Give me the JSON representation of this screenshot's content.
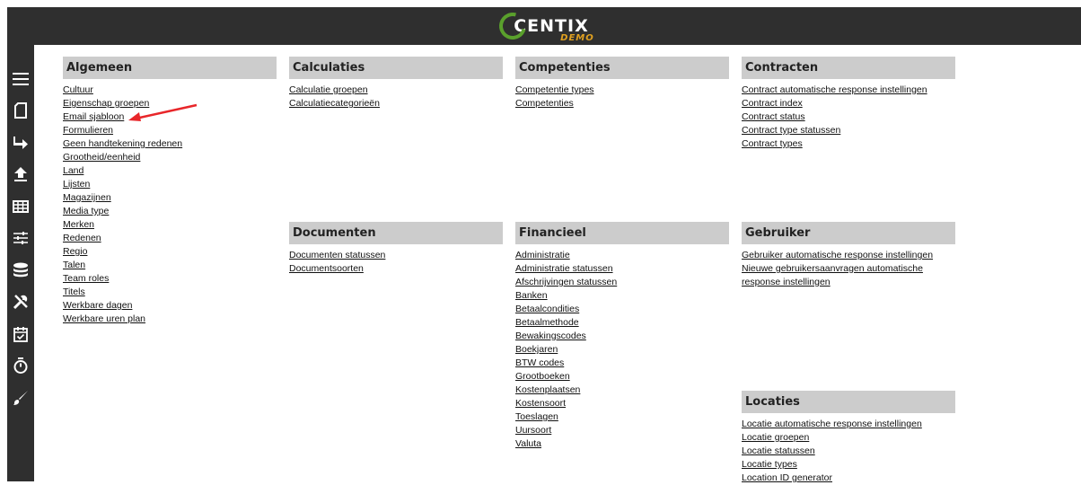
{
  "header": {
    "logo_text": "CENTIX",
    "logo_sub": "DEMO"
  },
  "sidebar": {
    "items": [
      {
        "icon": "menu-icon"
      },
      {
        "icon": "document-icon"
      },
      {
        "icon": "share-arrow-icon"
      },
      {
        "icon": "upload-icon"
      },
      {
        "icon": "table-icon"
      },
      {
        "icon": "sliders-icon"
      },
      {
        "icon": "database-icon"
      },
      {
        "icon": "tools-icon"
      },
      {
        "icon": "calendar-check-icon"
      },
      {
        "icon": "stopwatch-icon"
      },
      {
        "icon": "paintbrush-icon"
      }
    ]
  },
  "sections": {
    "algemeen": {
      "title": "Algemeen",
      "links": [
        "Cultuur",
        "Eigenschap groepen",
        "Email sjabloon",
        "Formulieren",
        "Geen handtekening redenen",
        "Grootheid/eenheid",
        "Land",
        "Lijsten",
        "Magazijnen",
        "Media type",
        "Merken",
        "Redenen",
        "Regio",
        "Talen",
        "Team roles",
        "Titels",
        "Werkbare dagen",
        "Werkbare uren plan"
      ]
    },
    "calculaties": {
      "title": "Calculaties",
      "links": [
        "Calculatie groepen",
        "Calculatiecategorieën"
      ]
    },
    "competenties": {
      "title": "Competenties",
      "links": [
        "Competentie types",
        "Competenties"
      ]
    },
    "contracten": {
      "title": "Contracten",
      "links": [
        "Contract automatische response instellingen",
        "Contract index",
        "Contract status",
        "Contract type statussen",
        "Contract types"
      ]
    },
    "documenten": {
      "title": "Documenten",
      "links": [
        "Documenten statussen",
        "Documentsoorten"
      ]
    },
    "financieel": {
      "title": "Financieel",
      "links": [
        "Administratie",
        "Administratie statussen",
        "Afschrijvingen statussen",
        "Banken",
        "Betaalcondities",
        "Betaalmethode",
        "Bewakingscodes",
        "Boekjaren",
        "BTW codes",
        "Grootboeken",
        "Kostenplaatsen",
        "Kostensoort",
        "Toeslagen",
        "Uursoort",
        "Valuta"
      ]
    },
    "gebruiker": {
      "title": "Gebruiker",
      "links": [
        "Gebruiker automatische response instellingen",
        "Nieuwe gebruikersaanvragen automatische response instellingen"
      ]
    },
    "locaties": {
      "title": "Locaties",
      "links": [
        "Locatie automatische response instellingen",
        "Locatie groepen",
        "Locatie statussen",
        "Locatie types",
        "Location ID generator"
      ]
    }
  },
  "annotation": {
    "arrow_color": "#e8262a"
  }
}
